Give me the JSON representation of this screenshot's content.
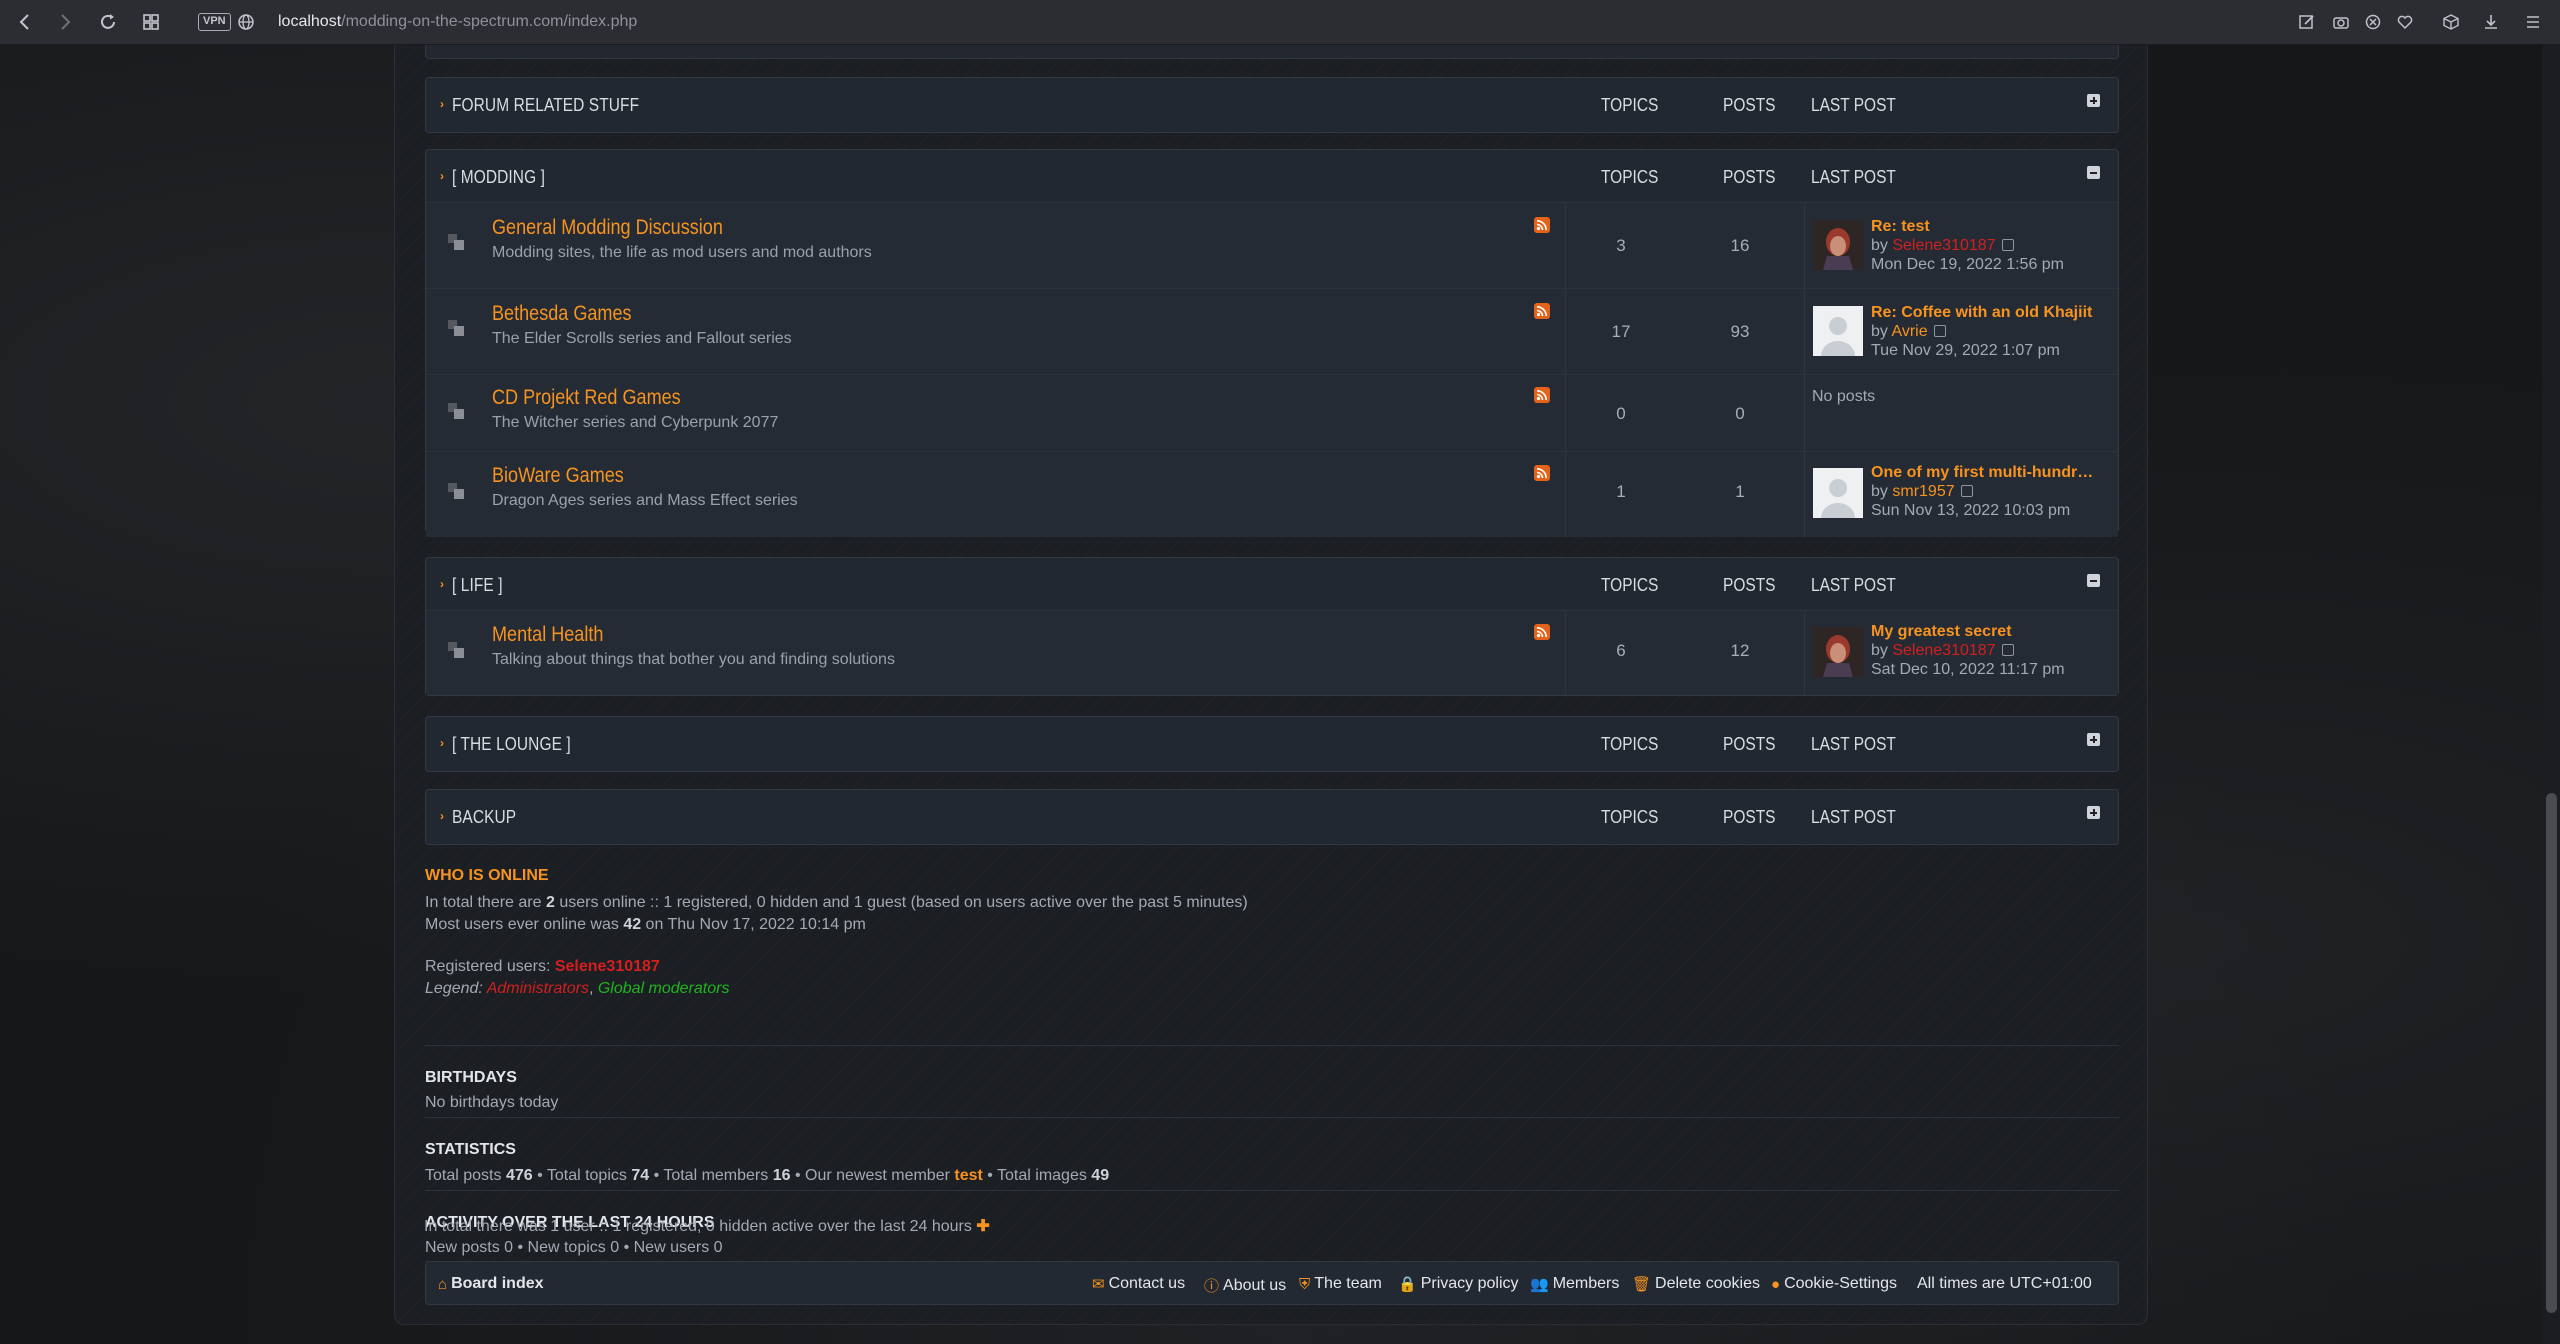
{
  "browser": {
    "vpn_label": "VPN",
    "url_host": "localhost",
    "url_path": "/modding-on-the-spectrum.com/index.php"
  },
  "categories": [
    {
      "title": "FORUM RELATED STUFF",
      "collapsed": true,
      "col_topics": "TOPICS",
      "col_posts": "POSTS",
      "col_last": "LAST POST"
    },
    {
      "title": "[ MODDING ]",
      "collapsed": false,
      "col_topics": "TOPICS",
      "col_posts": "POSTS",
      "col_last": "LAST POST",
      "forums": [
        {
          "name": "General Modding Discussion",
          "desc": "Modding sites, the life as mod users and mod authors",
          "topics": "3",
          "posts": "16",
          "lp_title": "Re: test",
          "lp_by": "by",
          "lp_user": "Selene310187",
          "lp_date": "Mon Dec 19, 2022 1:56 pm"
        },
        {
          "name": "Bethesda Games",
          "desc": "The Elder Scrolls series and Fallout series",
          "topics": "17",
          "posts": "93",
          "lp_title": "Re: Coffee with an old Khajiit",
          "lp_by": "by",
          "lp_user": "Avrie",
          "lp_date": "Tue Nov 29, 2022 1:07 pm"
        },
        {
          "name": "CD Projekt Red Games",
          "desc": "The Witcher series and Cyberpunk 2077",
          "topics": "0",
          "posts": "0",
          "no_posts": "No posts"
        },
        {
          "name": "BioWare Games",
          "desc": "Dragon Ages series and Mass Effect series",
          "topics": "1",
          "posts": "1",
          "lp_title": "One of my first multi-hundr…",
          "lp_by": "by",
          "lp_user": "smr1957",
          "lp_date": "Sun Nov 13, 2022 10:03 pm"
        }
      ]
    },
    {
      "title": "[ LIFE ]",
      "collapsed": false,
      "col_topics": "TOPICS",
      "col_posts": "POSTS",
      "col_last": "LAST POST",
      "forums": [
        {
          "name": "Mental Health",
          "desc": "Talking about things that bother you and finding solutions",
          "topics": "6",
          "posts": "12",
          "lp_title": "My greatest secret",
          "lp_by": "by",
          "lp_user": "Selene310187",
          "lp_date": "Sat Dec 10, 2022 11:17 pm"
        }
      ]
    },
    {
      "title": "[ THE LOUNGE ]",
      "collapsed": true,
      "col_topics": "TOPICS",
      "col_posts": "POSTS",
      "col_last": "LAST POST"
    },
    {
      "title": "BACKUP",
      "collapsed": true,
      "col_topics": "TOPICS",
      "col_posts": "POSTS",
      "col_last": "LAST POST"
    }
  ],
  "online": {
    "title": "WHO IS ONLINE",
    "line1_a": "In total there are ",
    "line1_count": "2",
    "line1_b": " users online :: 1 registered, 0 hidden and 1 guest (based on users active over the past 5 minutes)",
    "line2_a": "Most users ever online was ",
    "line2_count": "42",
    "line2_b": " on Thu Nov 17, 2022 10:14 pm",
    "registered_label": "Registered users: ",
    "registered_user": "Selene310187",
    "legend_label": "Legend: ",
    "legend_admins": "Administrators",
    "legend_sep": ", ",
    "legend_mods": "Global moderators"
  },
  "birthdays": {
    "title": "BIRTHDAYS",
    "text": "No birthdays today"
  },
  "statistics": {
    "title": "STATISTICS",
    "posts_label": "Total posts ",
    "posts": "476",
    "topics_label": " • Total topics ",
    "topics": "74",
    "members_label": " • Total members ",
    "members": "16",
    "newest_label": " • Our newest member ",
    "newest": "test",
    "images_label": " • Total images ",
    "images": "49"
  },
  "activity": {
    "title": "ACTIVITY OVER THE LAST 24 HOURS",
    "line1": "New posts 0 • New topics 0 • New users 0",
    "line2": "In total there was 1 user :: 1 registered, 0 hidden active over the last 24 hours"
  },
  "footer": {
    "board_index": "Board index",
    "contact": "Contact us",
    "about": "About us",
    "team": "The team",
    "privacy": "Privacy policy",
    "members": "Members",
    "delete_cookies": "Delete cookies",
    "cookie_settings": "Cookie-Settings",
    "timezone": "All times are UTC+01:00"
  },
  "colors": {
    "accent": "#f7931e",
    "admin_red": "#d31f1f",
    "moderator_green": "#1fb51f"
  }
}
